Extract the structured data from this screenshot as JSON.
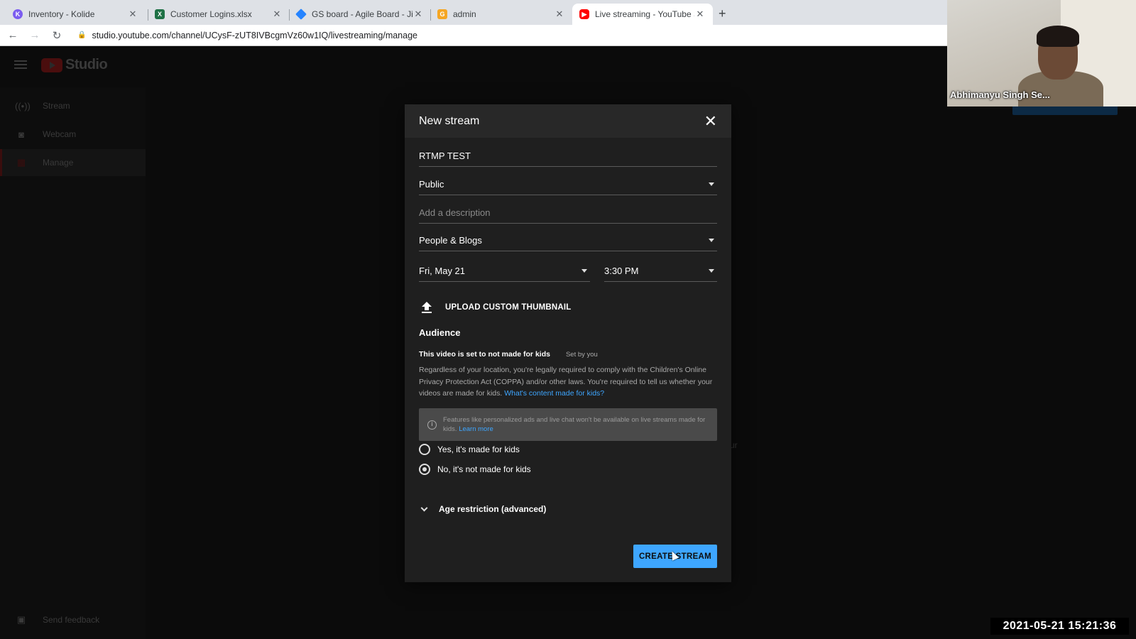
{
  "browser": {
    "tabs": [
      {
        "title": "Inventory - Kolide",
        "favicon": "kolide-icon",
        "color": "#7b5cf0"
      },
      {
        "title": "Customer Logins.xlsx",
        "favicon": "excel-icon",
        "color": "#1e7145"
      },
      {
        "title": "GS board - Agile Board - Jira",
        "favicon": "jira-icon",
        "color": "#2684ff"
      },
      {
        "title": "admin",
        "favicon": "admin-icon",
        "color": "#f5a623"
      },
      {
        "title": "Live streaming - YouTube Stud",
        "favicon": "youtube-icon",
        "color": "#ff0000"
      }
    ],
    "url": "studio.youtube.com/channel/UCysF-zUT8IVBcgmVz60w1IQ/livestreaming/manage"
  },
  "studio": {
    "logo_text": "Studio",
    "sidebar": [
      {
        "label": "Stream",
        "icon": "broadcast-icon"
      },
      {
        "label": "Webcam",
        "icon": "camera-icon"
      },
      {
        "label": "Manage",
        "icon": "calendar-icon"
      }
    ],
    "feedback": "Send feedback",
    "stray_text": "ur"
  },
  "modal": {
    "title": "New stream",
    "title_value": "RTMP TEST",
    "visibility": "Public",
    "description_placeholder": "Add a description",
    "category": "People & Blogs",
    "date": "Fri, May 21",
    "time": "3:30 PM",
    "upload_label": "UPLOAD CUSTOM THUMBNAIL",
    "audience": {
      "heading": "Audience",
      "status": "This video is set to not made for kids",
      "set_by": "Set by you",
      "description": "Regardless of your location, you're legally required to comply with the Children's Online Privacy Protection Act (COPPA) and/or other laws. You're required to tell us whether your videos are made for kids.",
      "description_link": "What's content made for kids?",
      "info": "Features like personalized ads and live chat won't be available on live streams made for kids.",
      "info_link": "Learn more",
      "option_yes": "Yes, it's made for kids",
      "option_no": "No, it's not made for kids",
      "selected": "no"
    },
    "age_restriction": "Age restriction (advanced)",
    "create_button": "CREATE STREAM"
  },
  "webcam": {
    "participant_name": "Abhimanyu Singh Se..."
  },
  "timestamp": "2021-05-21  15:21:36"
}
